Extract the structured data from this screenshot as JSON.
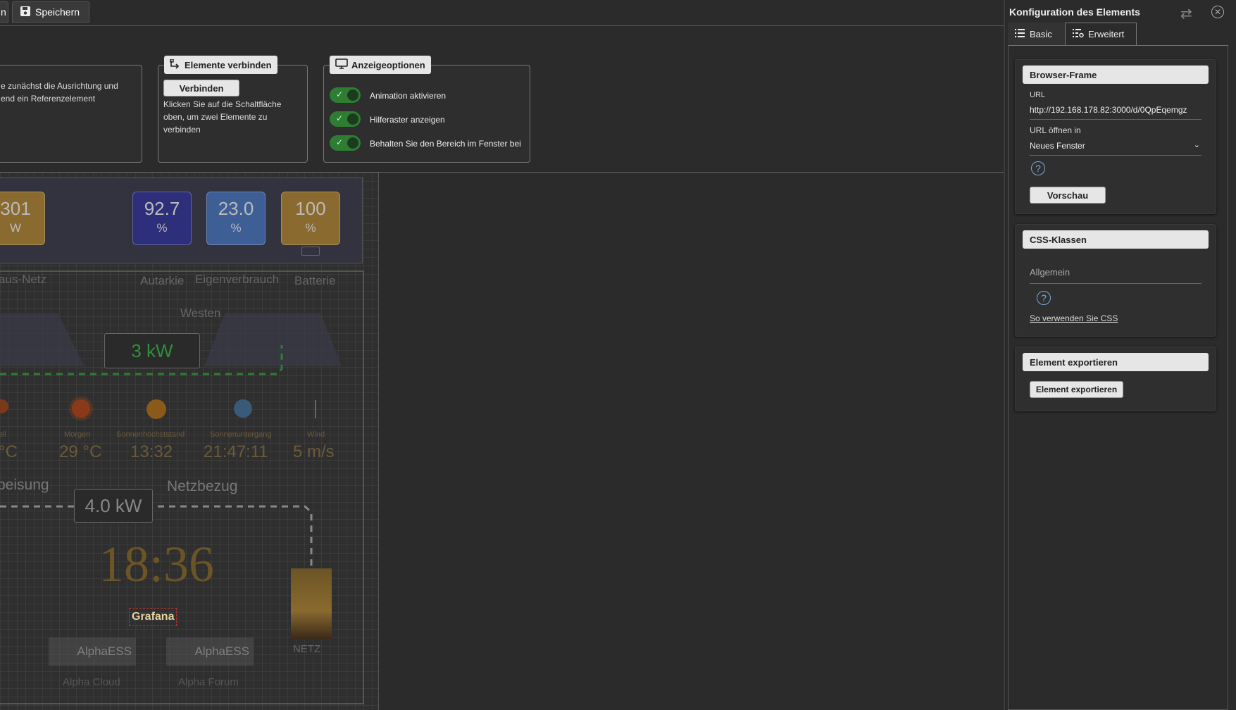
{
  "toolbar": {
    "partial_label": "n",
    "save_label": "Speichern"
  },
  "groups": {
    "align": {
      "text_line1": "e zunächst die Ausrichtung und",
      "text_line2": "end ein Referenzelement"
    },
    "connect": {
      "title": "Elemente verbinden",
      "button": "Verbinden",
      "text": "Klicken Sie auf die Schaltfläche oben, um zwei Elemente zu verbinden"
    },
    "display": {
      "title": "Anzeigeoptionen",
      "options": [
        {
          "label": "Animation aktivieren",
          "on": true
        },
        {
          "label": "Hilferaster anzeigen",
          "on": true
        },
        {
          "label": "Behalten Sie den Bereich im Fenster bei",
          "on": true
        }
      ]
    }
  },
  "canvas": {
    "tiles": [
      {
        "value": "301",
        "unit": "W",
        "color": "#8a6a2e"
      },
      {
        "value": "92.7",
        "unit": "%",
        "color": "#2e2f7a"
      },
      {
        "value": "23.0",
        "unit": "%",
        "color": "#3e5e96"
      },
      {
        "value": "100",
        "unit": "%",
        "color": "#8a6a2e"
      }
    ],
    "labels": {
      "haus_netz": "aus-Netz",
      "autarkie": "Autarkie",
      "eigenverbrauch": "Eigenverbrauch",
      "batterie": "Batterie",
      "westen": "Westen",
      "pv_kw": "3 kW",
      "grid_kw": "4.0 kW",
      "einspeisung": "beisung",
      "netzbezug": "Netzbezug",
      "clock": "18:36",
      "grafana": "Grafana",
      "netz": "NETZ",
      "alpha_cloud": "Alpha Cloud",
      "alpha_forum": "Alpha Forum",
      "alphaess_logo": "AlphaESS"
    },
    "weather": [
      {
        "title": "ell",
        "value": "°C"
      },
      {
        "title": "Morgen",
        "value": "29 °C"
      },
      {
        "title": "Sonnenhöchststand",
        "value": "13:32"
      },
      {
        "title": "Sonnenuntergang",
        "value": "21:47:11"
      },
      {
        "title": "Wind",
        "value": "5 m/s"
      }
    ]
  },
  "right_panel": {
    "title": "Konfiguration des Elements",
    "tabs": {
      "basic": "Basic",
      "advanced": "Erweitert"
    },
    "browser_frame": {
      "header": "Browser-Frame",
      "url_label": "URL",
      "url_value": "http://192.168.178.82:3000/d/0QpEqemgz",
      "open_in_label": "URL öffnen in",
      "open_in_value": "Neues Fenster",
      "preview_button": "Vorschau"
    },
    "css_classes": {
      "header": "CSS-Klassen",
      "general_placeholder": "Allgemein",
      "css_link": "So verwenden Sie CSS"
    },
    "export": {
      "header": "Element exportieren",
      "button": "Element exportieren"
    }
  }
}
